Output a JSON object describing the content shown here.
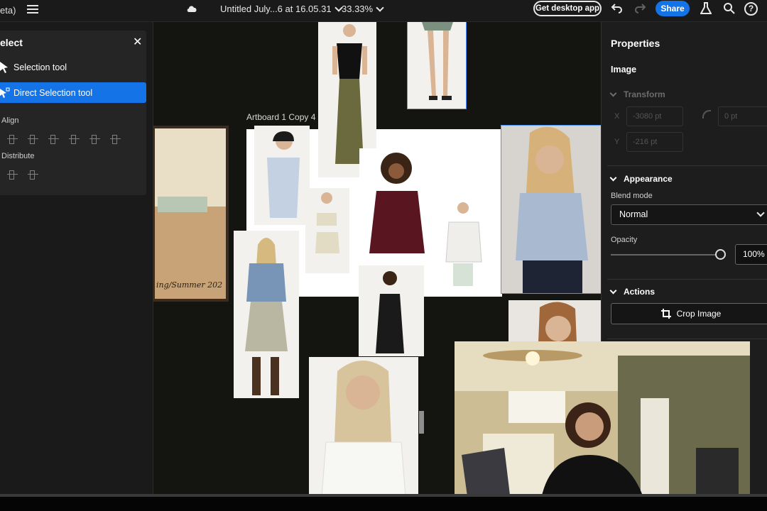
{
  "topbar": {
    "brand": "eta)",
    "doc_title": "Untitled July...6 at 16.05.31",
    "zoom": "33.33%",
    "get_desktop_label": "Get desktop app",
    "share_label": "Share",
    "help_label": "?"
  },
  "left_panel": {
    "title": "elect",
    "close_glyph": "✕",
    "tools": [
      {
        "label": "Selection tool",
        "active": false
      },
      {
        "label": "Direct Selection tool",
        "active": true
      }
    ],
    "align_label": "Align",
    "distribute_label": "Distribute"
  },
  "canvas": {
    "artboard_label": "Artboard 1 Copy 4",
    "poster_text": "ing/Summer  202"
  },
  "properties": {
    "title": "Properties",
    "subtitle": "Image",
    "transform_label": "Transform",
    "x_label": "X",
    "y_label": "Y",
    "x_value": "-3080 pt",
    "y_value": "-216 pt",
    "radius_value": "0 pt",
    "appearance_label": "Appearance",
    "blend_mode_label": "Blend mode",
    "blend_mode_value": "Normal",
    "opacity_label": "Opacity",
    "opacity_value": "100%",
    "opacity_level": 1.0,
    "actions_label": "Actions",
    "crop_label": "Crop Image"
  },
  "colors": {
    "accent": "#1473e6",
    "panel": "#252525",
    "canvas": "#141410"
  }
}
